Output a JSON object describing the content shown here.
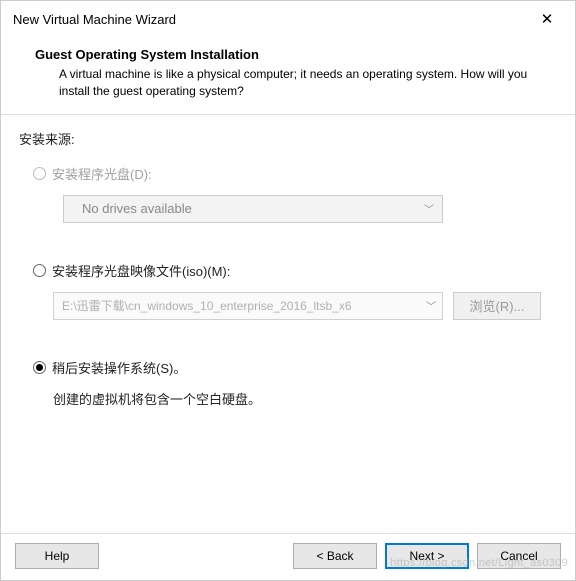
{
  "window": {
    "title": "New Virtual Machine Wizard"
  },
  "header": {
    "title": "Guest Operating System Installation",
    "description": "A virtual machine is like a physical computer; it needs an operating system. How will you install the guest operating system?"
  },
  "content": {
    "source_label": "安装来源:",
    "options": {
      "disc": {
        "label": "安装程序光盘(D):",
        "dropdown_text": "No drives available"
      },
      "iso": {
        "label": "安装程序光盘映像文件(iso)(M):",
        "path": "E:\\迅雷下载\\cn_windows_10_enterprise_2016_ltsb_x6",
        "browse_label": "浏览(R)..."
      },
      "later": {
        "label": "稍后安装操作系统(S)。",
        "description": "创建的虚拟机将包含一个空白硬盘。"
      }
    }
  },
  "footer": {
    "help": "Help",
    "back": "< Back",
    "next": "Next >",
    "cancel": "Cancel"
  },
  "watermark": "https://blog.csdn.net/Light_as0309"
}
